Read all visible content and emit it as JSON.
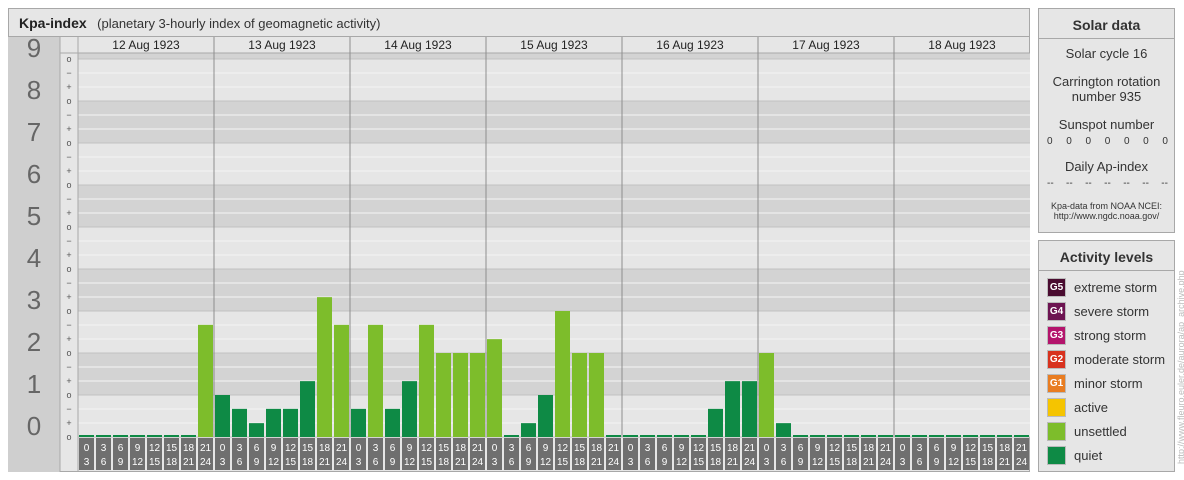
{
  "header": {
    "title": "Kpa-index",
    "subtitle": "(planetary 3-hourly index of geomagnetic activity)"
  },
  "chart_data": {
    "type": "bar",
    "days": [
      "12 Aug 1923",
      "13 Aug 1923",
      "14 Aug 1923",
      "15 Aug 1923",
      "16 Aug 1923",
      "17 Aug 1923",
      "18 Aug 1923"
    ],
    "interval_start_labels": [
      "0",
      "3",
      "6",
      "9",
      "12",
      "15",
      "18",
      "21"
    ],
    "interval_end_labels": [
      "3",
      "6",
      "9",
      "12",
      "15",
      "18",
      "21",
      "24"
    ],
    "y_tick_labels": [
      "0",
      "1",
      "2",
      "3",
      "4",
      "5",
      "6",
      "7",
      "8",
      "9"
    ],
    "minor_tick_labels": [
      "o",
      "+",
      "−"
    ],
    "ylim": [
      0,
      9.33
    ],
    "series": [
      {
        "values": [
          0,
          0,
          0,
          0,
          0,
          0,
          0,
          2.67,
          1,
          0.67,
          0.33,
          0.67,
          0.67,
          1.33,
          3.33,
          2.67,
          0.67,
          2.67,
          0.67,
          1.33,
          2.67,
          2,
          2,
          2,
          2.33,
          0,
          0.33,
          1,
          3,
          2,
          2,
          0,
          0,
          0,
          0,
          0,
          0,
          0.67,
          1.33,
          1.33,
          2,
          0.33,
          0,
          0,
          0,
          0,
          0,
          0,
          0,
          0,
          0,
          0,
          0,
          0,
          0,
          0
        ]
      }
    ],
    "bar_color_rule": "values below 2 quiet color; values from 2 to below 4 unsettled color",
    "grid": true
  },
  "solar_data": {
    "title": "Solar data",
    "solar_cycle": "Solar cycle 16",
    "carrington": "Carrington rotation number 935",
    "sunspot_label": "Sunspot number",
    "sunspot_values": [
      "0",
      "0",
      "0",
      "0",
      "0",
      "0",
      "0"
    ],
    "ap_label": "Daily Ap-index",
    "ap_values": [
      "--",
      "--",
      "--",
      "--",
      "--",
      "--",
      "--"
    ],
    "source_line1": "Kpa-data from NOAA NCEI:",
    "source_line2": "http://www.ngdc.noaa.gov/"
  },
  "activity_levels": {
    "title": "Activity levels",
    "items": [
      {
        "badge": "G5",
        "label": "extreme storm",
        "color": "#4a0c30"
      },
      {
        "badge": "G4",
        "label": "severe storm",
        "color": "#6d1452"
      },
      {
        "badge": "G3",
        "label": "strong storm",
        "color": "#b4146c"
      },
      {
        "badge": "G2",
        "label": "moderate storm",
        "color": "#d8321e"
      },
      {
        "badge": "G1",
        "label": "minor storm",
        "color": "#e97d22"
      },
      {
        "badge": "",
        "label": "active",
        "color": "#f5c400"
      },
      {
        "badge": "",
        "label": "unsettled",
        "color": "#7dbd2b"
      },
      {
        "badge": "",
        "label": "quiet",
        "color": "#0e8a45"
      }
    ]
  },
  "credit": "http://www.fleuro.euler.de/aurora/ap_archive.php"
}
